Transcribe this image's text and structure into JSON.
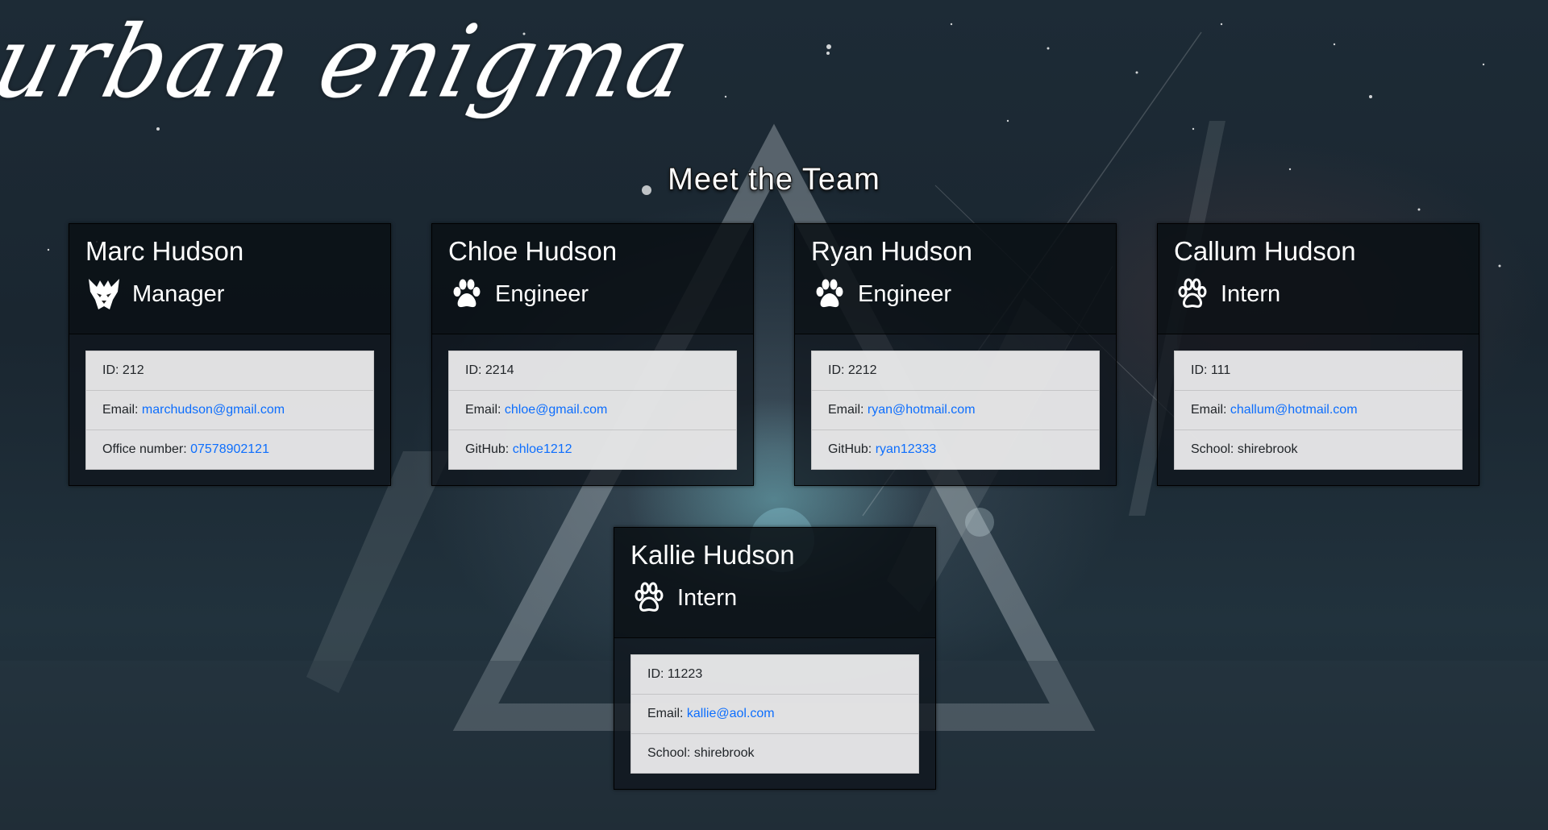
{
  "site": {
    "banner_text": "urban enigma",
    "page_title": "Meet the Team"
  },
  "team": [
    {
      "name": "Marc Hudson",
      "role": "Manager",
      "icon": "wolf-icon",
      "id_label": "ID:",
      "id_value": "212",
      "email_label": "Email:",
      "email": "marchudson@gmail.com",
      "extra_label": "Office number:",
      "extra_value": "07578902121"
    },
    {
      "name": "Chloe Hudson",
      "role": "Engineer",
      "icon": "paw-icon",
      "id_label": "ID:",
      "id_value": "2214",
      "email_label": "Email:",
      "email": "chloe@gmail.com",
      "extra_label": "GitHub:",
      "extra_value": "chloe1212"
    },
    {
      "name": "Ryan Hudson",
      "role": "Engineer",
      "icon": "paw-icon",
      "id_label": "ID:",
      "id_value": "2212",
      "email_label": "Email:",
      "email": "ryan@hotmail.com",
      "extra_label": "GitHub:",
      "extra_value": "ryan12333"
    },
    {
      "name": "Callum Hudson",
      "role": "Intern",
      "icon": "paw-outline-icon",
      "id_label": "ID:",
      "id_value": "111",
      "email_label": "Email:",
      "email": "challum@hotmail.com",
      "extra_label": "School:",
      "extra_value": "shirebrook"
    },
    {
      "name": "Kallie Hudson",
      "role": "Intern",
      "icon": "paw-outline-icon",
      "id_label": "ID:",
      "id_value": "11223",
      "email_label": "Email:",
      "email": "kallie@aol.com",
      "extra_label": "School:",
      "extra_value": "shirebrook"
    }
  ],
  "colors": {
    "link": "#0d6efd",
    "card_bg": "#0e141a",
    "list_bg": "#eeeeee",
    "text_dark": "#212529"
  }
}
